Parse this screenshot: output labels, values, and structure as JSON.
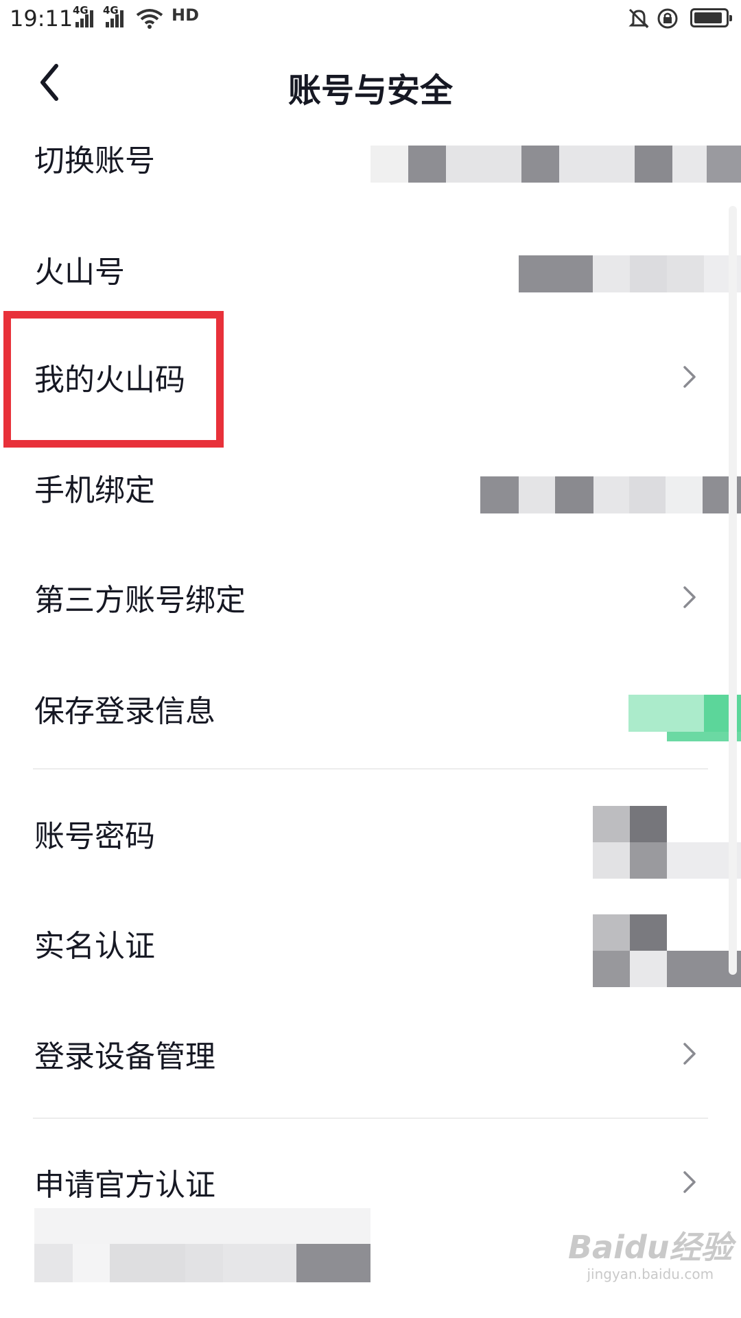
{
  "status_bar": {
    "time": "19:11",
    "network": [
      "4G",
      "4G"
    ],
    "hd_label": "HD",
    "icons": [
      "signal-icon",
      "wifi-icon",
      "mute-bell-icon",
      "rotation-lock-icon",
      "battery-icon"
    ],
    "battery_level": 0.8
  },
  "header": {
    "title": "账号与安全",
    "back_icon": "chevron-left-icon"
  },
  "rows": [
    {
      "label": "切换账号",
      "trailing": "pixelated-value"
    },
    {
      "label": "火山号",
      "trailing": "pixelated-value"
    },
    {
      "label": "我的火山码",
      "trailing": "chevron-right-icon"
    },
    {
      "label": "手机绑定",
      "trailing": "pixelated-value"
    },
    {
      "label": "第三方账号绑定",
      "trailing": "chevron-right-icon"
    },
    {
      "label": "保存登录信息",
      "trailing": "toggle-on"
    },
    {
      "label": "账号密码",
      "trailing": "pixelated-value"
    },
    {
      "label": "实名认证",
      "trailing": "pixelated-value"
    },
    {
      "label": "登录设备管理",
      "trailing": "chevron-right-icon"
    },
    {
      "label": "申请官方认证",
      "trailing": "chevron-right-icon"
    }
  ],
  "highlight_color": "#e8313a",
  "accent_color": "#5cd69a",
  "watermark": {
    "main": "Baidu经验",
    "sub": "jingyan.baidu.com"
  }
}
